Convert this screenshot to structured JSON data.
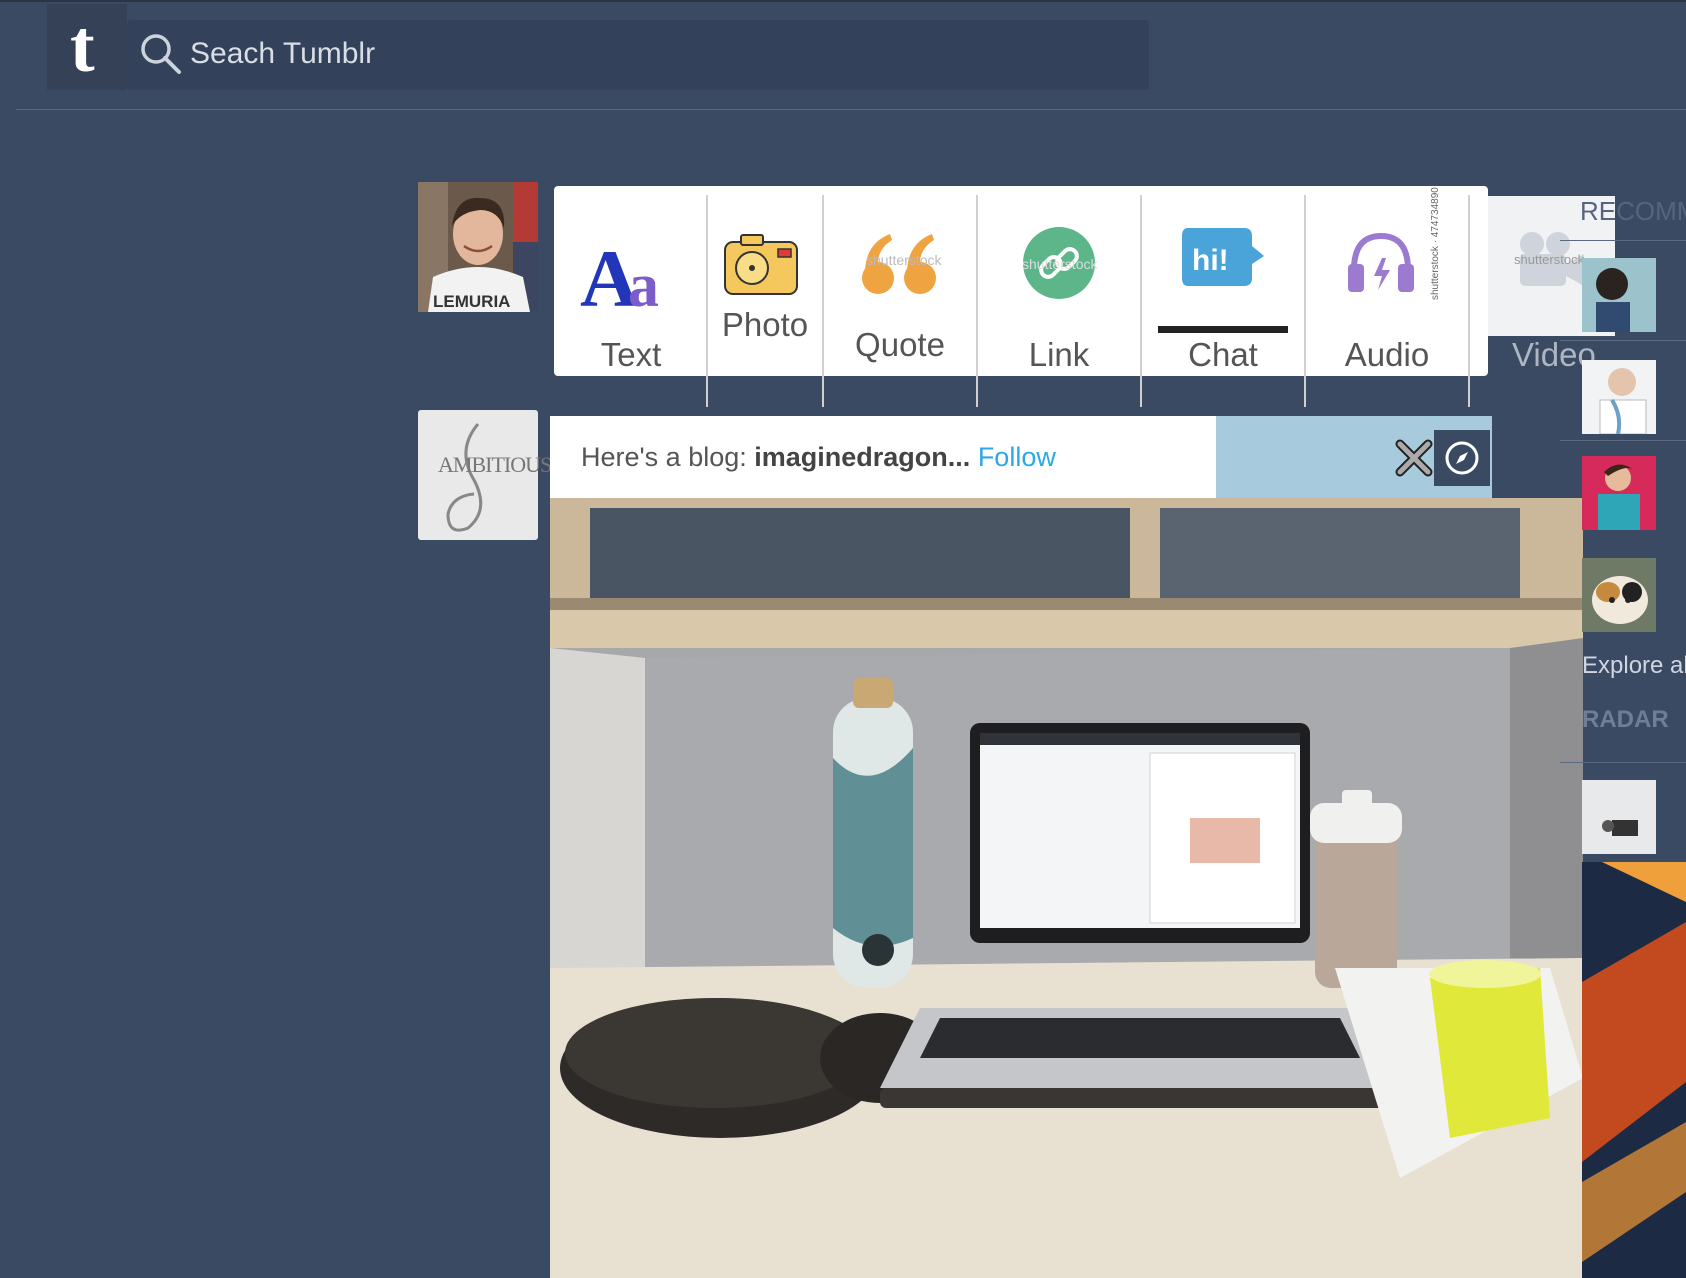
{
  "header": {
    "logo": "t",
    "search": {
      "placeholder": "Seach Tumblr",
      "value": ""
    }
  },
  "post_types": [
    {
      "label": "Text",
      "icon": "text-icon"
    },
    {
      "label": "Photo",
      "icon": "camera-icon"
    },
    {
      "label": "Quote",
      "icon": "quote-icon"
    },
    {
      "label": "Link",
      "icon": "link-icon"
    },
    {
      "label": "Chat",
      "icon": "chat-icon"
    },
    {
      "label": "Audio",
      "icon": "headphones-icon"
    },
    {
      "label": "Video",
      "icon": "video-camera-icon"
    }
  ],
  "recommended_blog": {
    "prefix": "Here's a blog:",
    "name": "imaginedragon...",
    "follow_label": "Follow",
    "avatar_text": "AMBITIOUS"
  },
  "user_avatar": {
    "shirt_text": "LEMURIA"
  },
  "stock_watermark": "shutterstock",
  "stock_id": "shutterstock · 474734890",
  "chat_bubble_text": "hi!",
  "right_rail": {
    "title": "RECOMM",
    "explore_label": "Explore al",
    "radar_label": "RADAR"
  },
  "colors": {
    "background": "#3a4a63",
    "follow_link": "#2ea7e8",
    "blog_bar_accent": "#a7cbdd"
  }
}
